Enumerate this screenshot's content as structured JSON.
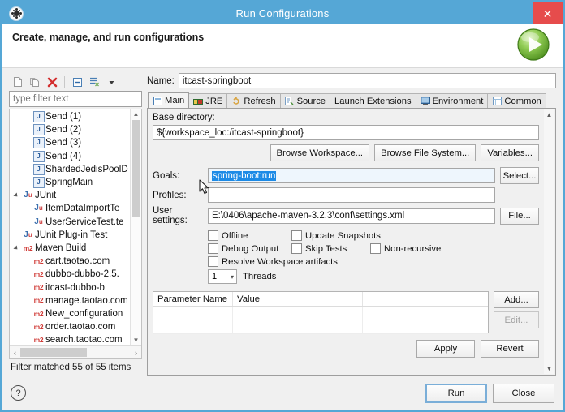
{
  "window": {
    "title": "Run Configurations",
    "icon": "gear-icon",
    "close_label": "✕",
    "accent_color": "#55a7d6",
    "close_color": "#e64c4c"
  },
  "header": {
    "title": "Create, manage, and run configurations",
    "run_icon": "run-green-play-icon"
  },
  "tree_toolbar": {
    "buttons": [
      {
        "name": "new-configuration",
        "glyph": "new"
      },
      {
        "name": "duplicate-configuration",
        "glyph": "duplicate"
      },
      {
        "name": "delete-configuration",
        "glyph": "delete"
      },
      {
        "name": "collapse-all",
        "glyph": "collapse"
      },
      {
        "name": "filter-configurations",
        "glyph": "filter"
      },
      {
        "name": "toolbar-menu",
        "glyph": "chevron-down"
      }
    ]
  },
  "filter": {
    "placeholder": "type filter text",
    "value": "",
    "status": "Filter matched 55 of 55 items"
  },
  "tree": {
    "items": [
      {
        "label": "Send (1)",
        "icon": "java-class-icon",
        "indent": 2,
        "expander": "none"
      },
      {
        "label": "Send (2)",
        "icon": "java-class-icon",
        "indent": 2,
        "expander": "none"
      },
      {
        "label": "Send (3)",
        "icon": "java-class-icon",
        "indent": 2,
        "expander": "none"
      },
      {
        "label": "Send (4)",
        "icon": "java-class-icon",
        "indent": 2,
        "expander": "none"
      },
      {
        "label": "ShardedJedisPoolD",
        "icon": "java-class-icon",
        "indent": 2,
        "expander": "none"
      },
      {
        "label": "SpringMain",
        "icon": "java-class-icon",
        "indent": 2,
        "expander": "none"
      },
      {
        "label": "JUnit",
        "icon": "junit-icon",
        "indent": 1,
        "expander": "expanded"
      },
      {
        "label": "ItemDataImportTe",
        "icon": "junit-icon",
        "indent": 2,
        "expander": "none"
      },
      {
        "label": "UserServiceTest.te",
        "icon": "junit-icon",
        "indent": 2,
        "expander": "none"
      },
      {
        "label": "JUnit Plug-in Test",
        "icon": "junit-plugin-icon",
        "indent": 1,
        "expander": "none"
      },
      {
        "label": "Maven Build",
        "icon": "maven-icon",
        "indent": 1,
        "expander": "expanded"
      },
      {
        "label": "cart.taotao.com",
        "icon": "maven-icon",
        "indent": 2,
        "expander": "none"
      },
      {
        "label": "dubbo-dubbo-2.5.",
        "icon": "maven-icon",
        "indent": 2,
        "expander": "none"
      },
      {
        "label": "itcast-dubbo-b",
        "icon": "maven-icon",
        "indent": 2,
        "expander": "none"
      },
      {
        "label": "manage.taotao.com",
        "icon": "maven-icon",
        "indent": 2,
        "expander": "none"
      },
      {
        "label": "New_configuration",
        "icon": "maven-icon",
        "indent": 2,
        "expander": "none"
      },
      {
        "label": "order.taotao.com",
        "icon": "maven-icon",
        "indent": 2,
        "expander": "none"
      },
      {
        "label": "search.taotao.com",
        "icon": "maven-icon",
        "indent": 2,
        "expander": "none"
      }
    ]
  },
  "config": {
    "name_label": "Name:",
    "name_value": "itcast-springboot"
  },
  "tabs": [
    {
      "label": "Main",
      "icon": "main-tab-icon",
      "active": true
    },
    {
      "label": "JRE",
      "icon": "jre-tab-icon",
      "active": false
    },
    {
      "label": "Refresh",
      "icon": "refresh-tab-icon",
      "active": false
    },
    {
      "label": "Source",
      "icon": "source-tab-icon",
      "active": false
    },
    {
      "label": "Launch Extensions",
      "icon": "",
      "active": false
    },
    {
      "label": "Environment",
      "icon": "environment-tab-icon",
      "active": false
    },
    {
      "label": "Common",
      "icon": "common-tab-icon",
      "active": false
    }
  ],
  "main_tab": {
    "base_directory_label": "Base directory:",
    "base_directory_value": "${workspace_loc:/itcast-springboot}",
    "browse_workspace_label": "Browse Workspace...",
    "browse_filesystem_label": "Browse File System...",
    "variables_label": "Variables...",
    "goals_label": "Goals:",
    "goals_value": "spring-boot:run",
    "goals_selected": true,
    "goals_selection_color": "#1c8ae6",
    "select_label": "Select...",
    "profiles_label": "Profiles:",
    "profiles_value": "",
    "user_settings_label": "User settings:",
    "user_settings_value": "E:\\0406\\apache-maven-3.2.3\\conf\\settings.xml",
    "file_label": "File...",
    "checkboxes": [
      {
        "label": "Offline",
        "checked": false
      },
      {
        "label": "Update Snapshots",
        "checked": false
      },
      {
        "label": "Debug Output",
        "checked": false
      },
      {
        "label": "Skip Tests",
        "checked": false
      },
      {
        "label": "Non-recursive",
        "checked": false
      },
      {
        "label": "Resolve Workspace artifacts",
        "checked": false
      }
    ],
    "threads_value": "1",
    "threads_label": "Threads",
    "parameter_table": {
      "columns": [
        "Parameter Name",
        "Value",
        ""
      ],
      "rows": []
    },
    "add_label": "Add...",
    "edit_label": "Edit...",
    "edit_disabled": true,
    "apply_label": "Apply",
    "revert_label": "Revert"
  },
  "footer": {
    "help_label": "?",
    "run_label": "Run",
    "close_label": "Close"
  }
}
